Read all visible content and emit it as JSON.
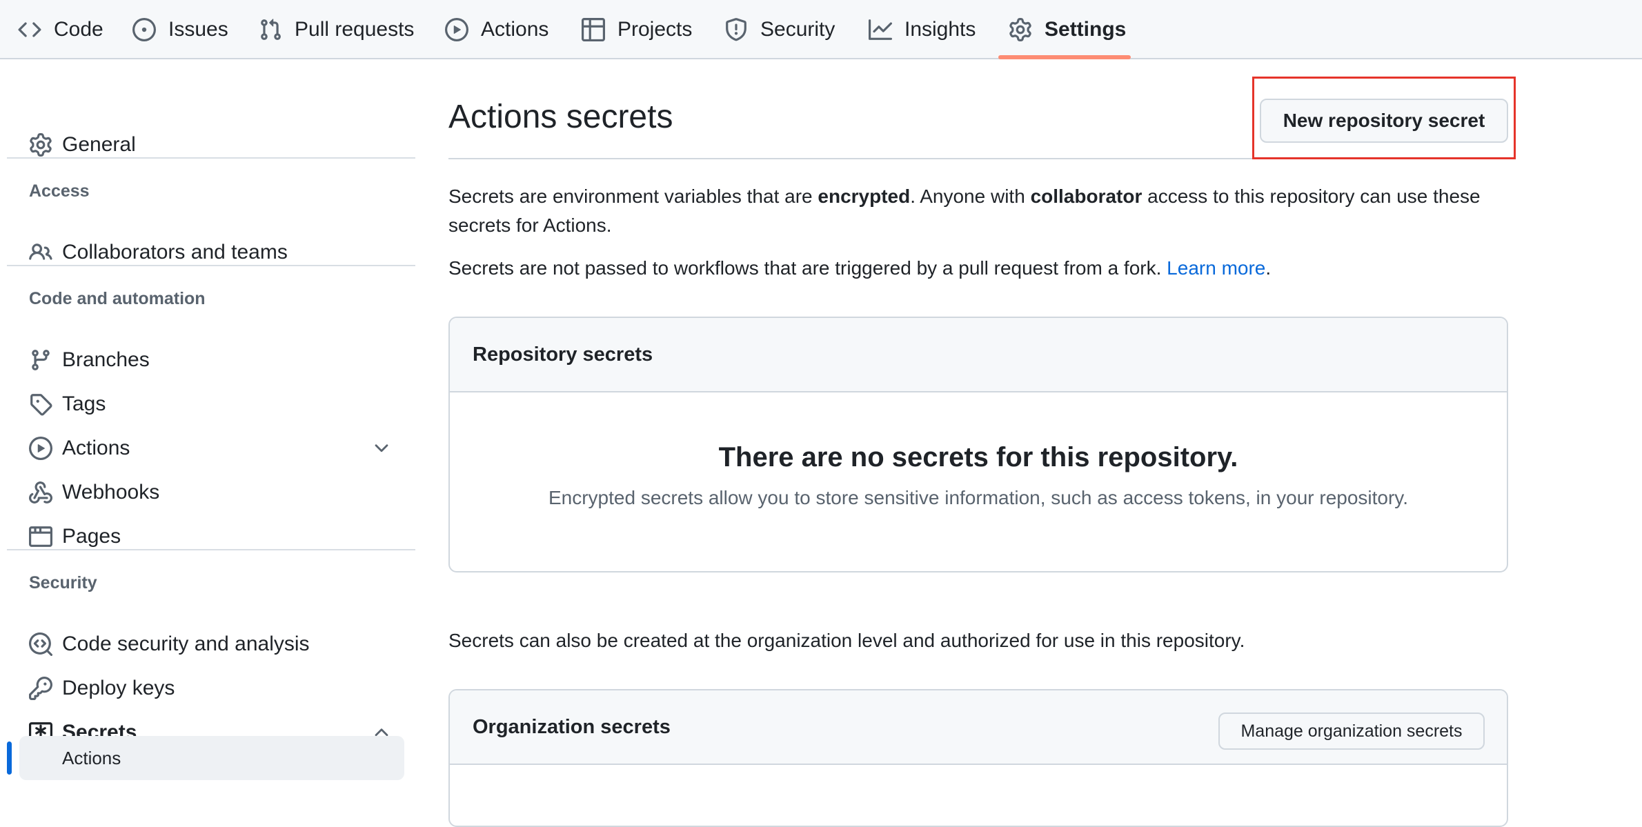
{
  "nav": {
    "tabs": [
      {
        "label": "Code",
        "icon": "code-icon"
      },
      {
        "label": "Issues",
        "icon": "issue-opened-icon"
      },
      {
        "label": "Pull requests",
        "icon": "pull-request-icon"
      },
      {
        "label": "Actions",
        "icon": "play-icon"
      },
      {
        "label": "Projects",
        "icon": "table-icon"
      },
      {
        "label": "Security",
        "icon": "shield-icon"
      },
      {
        "label": "Insights",
        "icon": "graph-icon"
      },
      {
        "label": "Settings",
        "icon": "gear-icon",
        "selected": true
      }
    ],
    "selected_underline_color": "#fd8c73"
  },
  "sidebar": {
    "general": "General",
    "sections": [
      {
        "heading": "Access",
        "items": [
          "Collaborators and teams"
        ]
      },
      {
        "heading": "Code and automation",
        "items": [
          "Branches",
          "Tags",
          "Actions",
          "Webhooks",
          "Pages"
        ]
      },
      {
        "heading": "Security",
        "items": [
          "Code security and analysis",
          "Deploy keys",
          "Secrets"
        ]
      }
    ],
    "selected_subitem": "Actions",
    "accent_color": "#0969da"
  },
  "main": {
    "title": "Actions secrets",
    "new_secret_button": "New repository secret",
    "intro": {
      "part1": "Secrets are environment variables that are ",
      "bold1": "encrypted",
      "part2": ". Anyone with ",
      "bold2": "collaborator",
      "part3": " access to this repository can use these secrets for Actions."
    },
    "fork_note": {
      "text": "Secrets are not passed to workflows that are triggered by a pull request from a fork. ",
      "link": "Learn more",
      "end": "."
    },
    "repo_secrets": {
      "header": "Repository secrets",
      "empty_title": "There are no secrets for this repository.",
      "empty_desc": "Encrypted secrets allow you to store sensitive information, such as access tokens, in your repository."
    },
    "org_note": "Secrets can also be created at the organization level and authorized for use in this repository.",
    "org_secrets": {
      "header": "Organization secrets",
      "manage_button": "Manage organization secrets"
    },
    "highlight_color": "#e5342a"
  }
}
